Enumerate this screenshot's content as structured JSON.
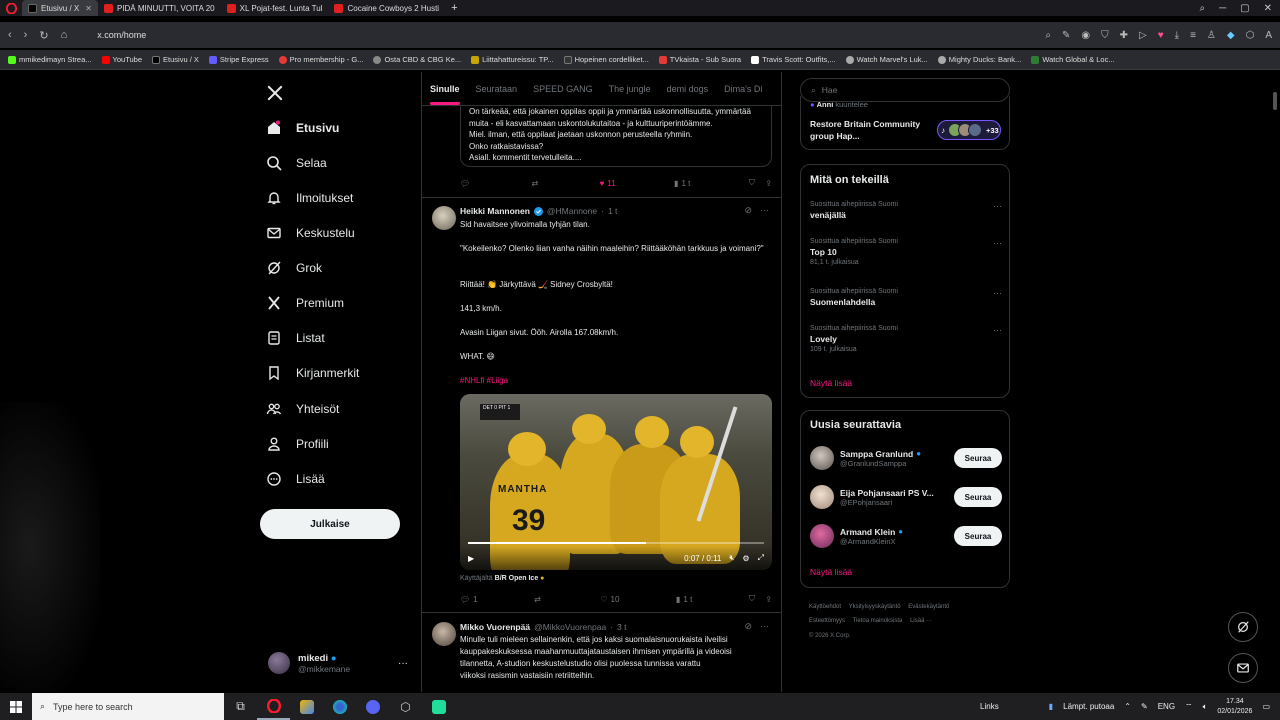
{
  "browser": {
    "tabs": [
      {
        "label": "Etusivu / X",
        "color": "#000000",
        "active": true
      },
      {
        "label": "PIDÄ MINUUTTI, VOITA 20",
        "color": "#e02020",
        "active": false
      },
      {
        "label": "XL Pojat-fest. Lunta Tul",
        "color": "#e02020",
        "active": false
      },
      {
        "label": "Cocaine Cowboys 2 Husti",
        "color": "#e02020",
        "active": false
      }
    ],
    "url": "x.com/home",
    "bookmarks": [
      {
        "label": "mmikedimayn Strea...",
        "color": "#53fc18"
      },
      {
        "label": "YouTube",
        "color": "#ff0000"
      },
      {
        "label": "Etusivu / X",
        "color": "#000000"
      },
      {
        "label": "Stripe Express",
        "color": "#635bff"
      },
      {
        "label": "Pro membership - G...",
        "color": "#e53935"
      },
      {
        "label": "Osta CBD & CBG Ke...",
        "color": "#888888"
      },
      {
        "label": "Liittahattureissu: TP...",
        "color": "#c8a800"
      },
      {
        "label": "Hopeinen cordelliket...",
        "color": "#333333"
      },
      {
        "label": "TVkaista - Sub Suora",
        "color": "#e53935"
      },
      {
        "label": "Travis Scott: Outfits,...",
        "color": "#ffffff"
      },
      {
        "label": "Watch Marvel's Luk...",
        "color": "#aaaaaa"
      },
      {
        "label": "Mighty Ducks: Bank...",
        "color": "#aaaaaa"
      },
      {
        "label": "Watch Global & Loc...",
        "color": "#2e7d32"
      }
    ]
  },
  "nav": {
    "items": [
      {
        "label": "Etusivu",
        "icon": "home-icon"
      },
      {
        "label": "Selaa",
        "icon": "search-icon"
      },
      {
        "label": "Ilmoitukset",
        "icon": "bell-icon"
      },
      {
        "label": "Keskustelu",
        "icon": "envelope-icon"
      },
      {
        "label": "Grok",
        "icon": "grok-icon"
      },
      {
        "label": "Premium",
        "icon": "x-icon"
      },
      {
        "label": "Listat",
        "icon": "list-icon"
      },
      {
        "label": "Kirjanmerkit",
        "icon": "bookmark-icon"
      },
      {
        "label": "Yhteisöt",
        "icon": "people-icon"
      },
      {
        "label": "Profiili",
        "icon": "person-icon"
      },
      {
        "label": "Lisää",
        "icon": "more-circle-icon"
      }
    ],
    "post_button": "Julkaise",
    "account": {
      "name": "mikedi",
      "handle": "@mikkemane"
    }
  },
  "feed": {
    "tabs": [
      "Sinulle",
      "Seurataan",
      "SPEED GANG",
      "The jungle",
      "demi dogs",
      "Dima's Di"
    ],
    "quoted_text": [
      "On tärkeää, että jokainen oppilas oppii ja ymmärtää uskonnollisuutta, ymmärtää",
      "muita - eli kasvattamaan uskontolukutaitoa - ja kulttuuriperintöämme.",
      "Miel. ilman, että oppilaat jaetaan uskonnon perusteella ryhmiin.",
      "Onko ratkaistavissa?",
      "Asiall. kommentit tervetulleita...."
    ],
    "first_actions": {
      "replies": "",
      "reposts": "",
      "likes": "11",
      "views": "1 t"
    },
    "post1": {
      "name": "Heikki Mannonen",
      "handle": "@HMannone",
      "time": "1 t",
      "lines": [
        "Sid havaitsee ylivoimalla tyhjän tilan.",
        "\"Kokeilenko? Olenko liian vanha näihin maaleihin? Riittääköhän tarkkuus ja voimani?\"",
        "Riittää! 👏 Järkyttävä 🏒 Sidney Crosbyltä!",
        "141,3 km/h.",
        "Avasin Liigan sivut. Ööh. Airolla 167.08km/h.",
        "WHAT. 😄"
      ],
      "hashtags": "#NHLfi #Liiga",
      "video": {
        "name": "MANTHA",
        "number": "39",
        "time": "0:07 / 0:11",
        "progress": 0.6,
        "scorebug": "DET 0  PIT 1"
      },
      "credit_prefix": "Käyttäjältä",
      "credit_source": "B/R Open Ice",
      "actions": {
        "replies": "1",
        "reposts": "",
        "likes": "10",
        "views": "1 t"
      }
    },
    "post2": {
      "name": "Mikko Vuorenpää",
      "handle": "@MikkoVuorenpaa",
      "time": "3 t",
      "lines": [
        "Minulle tuli mieleen sellainenkin, että jos kaksi suomalaisnuorukaista ilveilisi",
        "kauppakeskuksessa maahanmuuttajataustaisen ihmisen ympärillä ja videoisi",
        "tilannetta, A-studion keskustelustudio olisi puolessa tunnissa varattu",
        "viikoksi rasismin vastaisiin retriitteihin."
      ]
    }
  },
  "right": {
    "search_placeholder": "Hae",
    "spaces": {
      "host": "Anni",
      "status": "kuuntelee",
      "title": "Restore Britain Community group Hap...",
      "count": "+33"
    },
    "trends_title": "Mitä on tekeillä",
    "trends": [
      {
        "context": "Suosittua aihepiirissä Suomi",
        "topic": "venäjällä",
        "posts": ""
      },
      {
        "context": "Suosittua aihepiirissä Suomi",
        "topic": "Top 10",
        "posts": "81,1 t. julkaisua"
      },
      {
        "context": "Suosittua aihepiirissä Suomi",
        "topic": "Suomenlahdella",
        "posts": ""
      },
      {
        "context": "Suosittua aihepiirissä Suomi",
        "topic": "Lovely",
        "posts": "109 t. julkaisua"
      }
    ],
    "show_more": "Näytä lisää",
    "follow_title": "Uusia seurattavia",
    "follow": [
      {
        "name": "Samppa Granlund",
        "handle": "@GranlundSamppa",
        "button": "Seuraa"
      },
      {
        "name": "Eija Pohjansaari PS V...",
        "handle": "@EPohjansaari",
        "button": "Seuraa"
      },
      {
        "name": "Armand Klein",
        "handle": "@ArmandKleinX",
        "button": "Seuraa"
      }
    ],
    "footer": [
      "Käyttöehdot",
      "Yksityisyyskäytäntö",
      "Evästekäytäntö",
      "Esteettömyys",
      "Tietoa mainoksista",
      "Lisää ···",
      "© 2026 X Corp."
    ]
  },
  "taskbar": {
    "search_placeholder": "Type here to search",
    "links": "Links",
    "weather": "Lämpt. putoaa",
    "lang": "ENG",
    "time": "17.34",
    "date": "02/01/2026"
  }
}
